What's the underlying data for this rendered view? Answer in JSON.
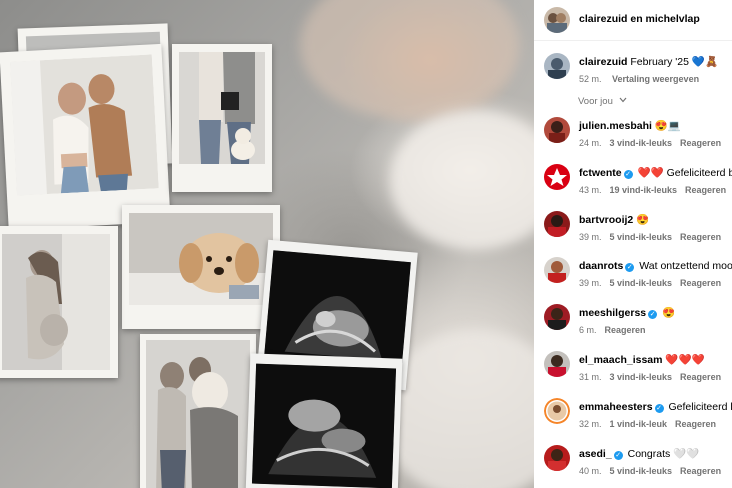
{
  "header": {
    "accounts": "clairezuid en michelvlap"
  },
  "caption": {
    "username": "clairezuid",
    "text": "February '25 💙🧸",
    "time": "52 m.",
    "translate": "Vertaling weergeven"
  },
  "filter": {
    "label": "Voor jou"
  },
  "comments": [
    {
      "username": "julien.mesbahi",
      "verified": false,
      "text": "😍💻",
      "time": "24 m.",
      "likes": "3 vind-ik-leuks",
      "reply": "Reageren"
    },
    {
      "username": "fctwente",
      "verified": true,
      "text": "❤️❤️ Gefeliciteerd be",
      "time": "43 m.",
      "likes": "19 vind-ik-leuks",
      "reply": "Reageren"
    },
    {
      "username": "bartvrooij2",
      "verified": false,
      "text": "😍",
      "time": "39 m.",
      "likes": "5 vind-ik-leuks",
      "reply": "Reageren"
    },
    {
      "username": "daanrots",
      "verified": true,
      "text": "Wat ontzettend mooi",
      "time": "39 m.",
      "likes": "5 vind-ik-leuks",
      "reply": "Reageren"
    },
    {
      "username": "meeshilgerss",
      "verified": true,
      "text": "😍",
      "time": "6 m.",
      "likes": "",
      "reply": "Reageren"
    },
    {
      "username": "el_maach_issam",
      "verified": false,
      "text": "❤️❤️❤️",
      "time": "31 m.",
      "likes": "3 vind-ik-leuks",
      "reply": "Reageren"
    },
    {
      "username": "emmaheesters",
      "verified": true,
      "text": "Gefeliciteerd lie",
      "time": "32 m.",
      "likes": "1 vind-ik-leuk",
      "reply": "Reageren"
    },
    {
      "username": "asedi_",
      "verified": true,
      "text": "Congrats 🤍🤍",
      "time": "40 m.",
      "likes": "5 vind-ik-leuks",
      "reply": "Reageren"
    }
  ],
  "colors": {
    "verified": "#1d9bf0",
    "muted": "#737373",
    "fctwente": "#d90012"
  },
  "icons": {
    "verified": "verified-badge-icon",
    "chevron": "chevron-down-icon"
  }
}
